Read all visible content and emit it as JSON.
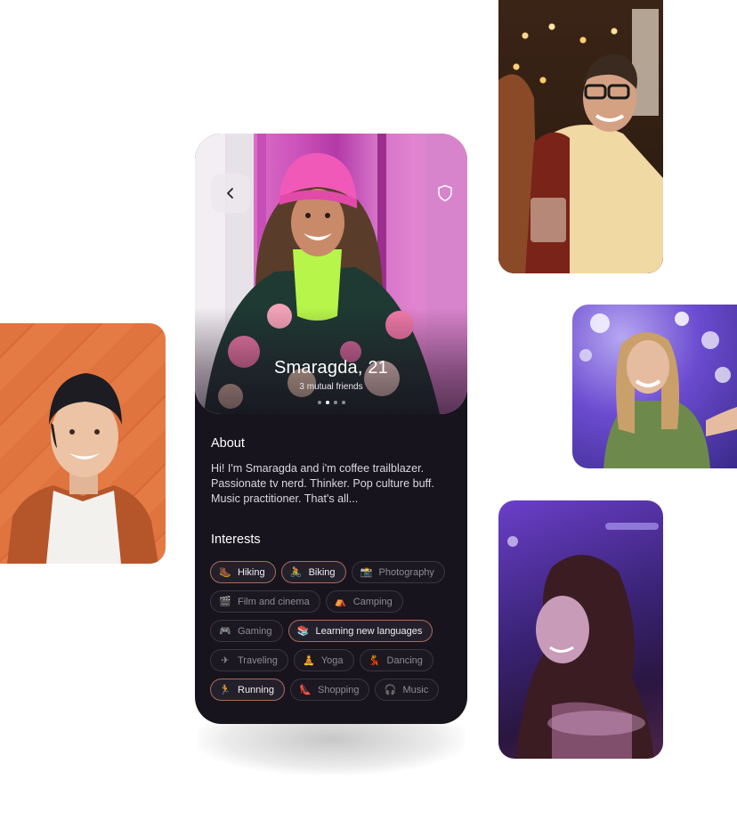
{
  "profile": {
    "name_age": "Smaragda, 21",
    "mutual_friends": "3 mutual friends",
    "photo_count": 4,
    "active_photo": 2
  },
  "about": {
    "title": "About",
    "text": "Hi! I'm Smaragda and i'm coffee trailblazer. Passionate tv nerd. Thinker. Pop culture buff. Music practitioner. That's all..."
  },
  "interests": {
    "title": "Interests",
    "items": [
      {
        "label": "Hiking",
        "icon": "hiking-boot-icon",
        "selected": true
      },
      {
        "label": "Biking",
        "icon": "biker-icon",
        "selected": true
      },
      {
        "label": "Photography",
        "icon": "camera-icon",
        "selected": false
      },
      {
        "label": "Film and cinema",
        "icon": "clapper-icon",
        "selected": false
      },
      {
        "label": "Camping",
        "icon": "tent-icon",
        "selected": false
      },
      {
        "label": "Gaming",
        "icon": "gamepad-icon",
        "selected": false
      },
      {
        "label": "Learning new languages",
        "icon": "books-icon",
        "selected": true
      },
      {
        "label": "Traveling",
        "icon": "airplane-icon",
        "selected": false
      },
      {
        "label": "Yoga",
        "icon": "yoga-icon",
        "selected": false
      },
      {
        "label": "Dancing",
        "icon": "dancer-icon",
        "selected": false
      },
      {
        "label": "Running",
        "icon": "runner-icon",
        "selected": true
      },
      {
        "label": "Shopping",
        "icon": "heel-shoe-icon",
        "selected": false
      },
      {
        "label": "Music",
        "icon": "headphones-icon",
        "selected": false
      }
    ]
  },
  "colors": {
    "app_background": "#17141d",
    "chip_selected_border": "#a86c59",
    "chip_border": "#3a3642"
  }
}
